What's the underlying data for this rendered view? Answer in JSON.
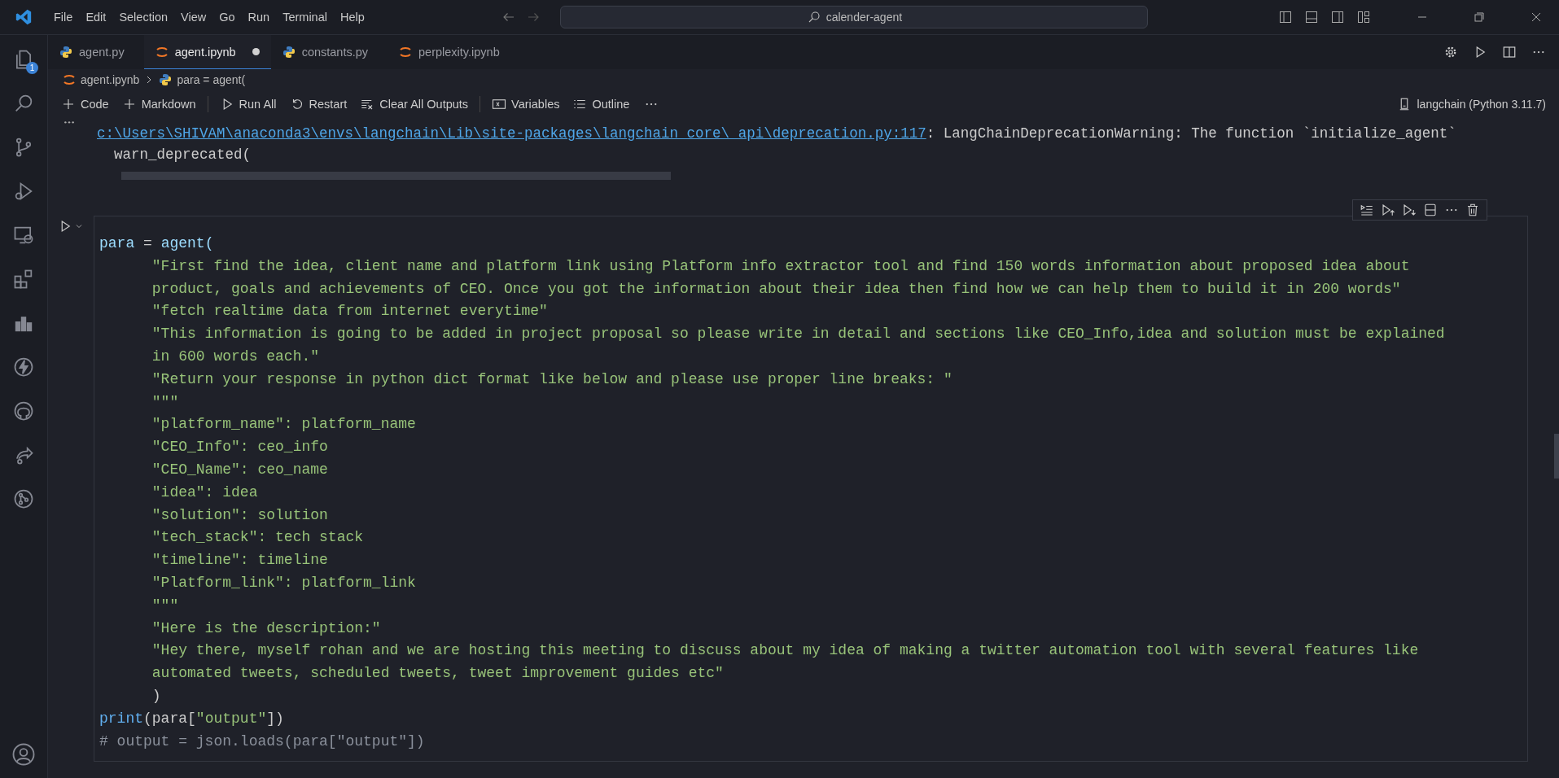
{
  "menu": [
    "File",
    "Edit",
    "Selection",
    "View",
    "Go",
    "Run",
    "Terminal",
    "Help"
  ],
  "search": {
    "value": "calender-agent"
  },
  "activity_bar": [
    {
      "kind": "files",
      "badge": "1",
      "selected": false
    },
    {
      "kind": "search",
      "selected": false
    },
    {
      "kind": "branch",
      "selected": false
    },
    {
      "kind": "debug",
      "selected": false
    },
    {
      "kind": "remote",
      "selected": false
    },
    {
      "kind": "extensions",
      "selected": false
    },
    {
      "kind": "chart",
      "selected": false
    },
    {
      "kind": "bolt",
      "selected": false
    },
    {
      "kind": "github",
      "selected": false
    },
    {
      "kind": "share",
      "selected": false
    },
    {
      "kind": "merge",
      "selected": false
    }
  ],
  "tabs": [
    {
      "label": "agent.py",
      "kind": "python",
      "selected": false,
      "modified": false
    },
    {
      "label": "agent.ipynb",
      "kind": "notebook",
      "selected": true,
      "modified": true
    },
    {
      "label": "constants.py",
      "kind": "python",
      "selected": false,
      "modified": false
    },
    {
      "label": "perplexity.ipynb",
      "kind": "notebook",
      "selected": false,
      "modified": false
    }
  ],
  "breadcrumb": [
    {
      "label": "agent.ipynb",
      "kind": "notebook"
    },
    {
      "label": "para = agent(",
      "kind": "python"
    }
  ],
  "toolbar": [
    [
      {
        "label": "Code",
        "kind": "plus"
      },
      {
        "label": "Markdown",
        "kind": "plus"
      }
    ],
    [
      {
        "label": "Run All",
        "kind": "run"
      },
      {
        "label": "Restart",
        "kind": "restart"
      },
      {
        "label": "Clear All Outputs",
        "kind": "clear"
      }
    ],
    [
      {
        "label": "Variables",
        "kind": "variables"
      },
      {
        "label": "Outline",
        "kind": "outline"
      }
    ]
  ],
  "kernel": "langchain (Python 3.11.7)",
  "output": {
    "link": "c:\\Users\\SHIVAM\\anaconda3\\envs\\langchain\\Lib\\site-packages\\langchain_core\\_api\\deprecation.py:117",
    "message": ": LangChainDeprecationWarning: The function `initialize_agent`",
    "line2": "  warn_deprecated("
  },
  "cell": {
    "lines": [
      [
        {
          "kind": "var",
          "text": "para"
        },
        {
          "kind": "plain",
          "text": " = "
        },
        {
          "kind": "var",
          "text": "agent("
        }
      ],
      [
        {
          "kind": "string",
          "text": "      \"First find the idea, client name and platform link using Platform info extractor tool and find 150 words information about proposed idea about"
        }
      ],
      [
        {
          "kind": "string",
          "text": "      product, goals and achievements of CEO. Once you got the information about their idea then find how we can help them to build it in 200 words\""
        }
      ],
      [
        {
          "kind": "string",
          "text": "      \"fetch realtime data from internet everytime\""
        }
      ],
      [
        {
          "kind": "string",
          "text": "      \"This information is going to be added in project proposal so please write in detail and sections like CEO_Info,idea and solution must be explained"
        }
      ],
      [
        {
          "kind": "string",
          "text": "      in 600 words each.\""
        }
      ],
      [
        {
          "kind": "string",
          "text": "      \"Return your response in python dict format like below and please use proper line breaks: \""
        }
      ],
      [
        {
          "kind": "string",
          "text": "      \"\"\""
        }
      ],
      [
        {
          "kind": "string",
          "text": "      \"platform_name\": platform_name"
        }
      ],
      [
        {
          "kind": "string",
          "text": "      \"CEO_Info\": ceo_info"
        }
      ],
      [
        {
          "kind": "string",
          "text": "      \"CEO_Name\": ceo_name"
        }
      ],
      [
        {
          "kind": "string",
          "text": "      \"idea\": idea"
        }
      ],
      [
        {
          "kind": "string",
          "text": "      \"solution\": solution"
        }
      ],
      [
        {
          "kind": "string",
          "text": "      \"tech_stack\": tech stack"
        }
      ],
      [
        {
          "kind": "string",
          "text": "      \"timeline\": timeline"
        }
      ],
      [
        {
          "kind": "string",
          "text": "      \"Platform_link\": platform_link"
        }
      ],
      [
        {
          "kind": "string",
          "text": "      \"\"\""
        }
      ],
      [
        {
          "kind": "string",
          "text": "      \"Here is the description:\""
        }
      ],
      [
        {
          "kind": "string",
          "text": "      \"Hey there, myself rohan and we are hosting this meeting to discuss about my idea of making a twitter automation tool with several features like"
        }
      ],
      [
        {
          "kind": "string",
          "text": "      automated tweets, scheduled tweets, tweet improvement guides etc\""
        }
      ],
      [
        {
          "kind": "plain",
          "text": "      )"
        }
      ],
      [
        {
          "kind": "func",
          "text": "print"
        },
        {
          "kind": "plain",
          "text": "(para["
        },
        {
          "kind": "string",
          "text": "\"output\""
        },
        {
          "kind": "plain",
          "text": "])"
        }
      ],
      [
        {
          "kind": "comment",
          "text": "# output = json.loads(para[\"output\"])"
        }
      ]
    ]
  }
}
